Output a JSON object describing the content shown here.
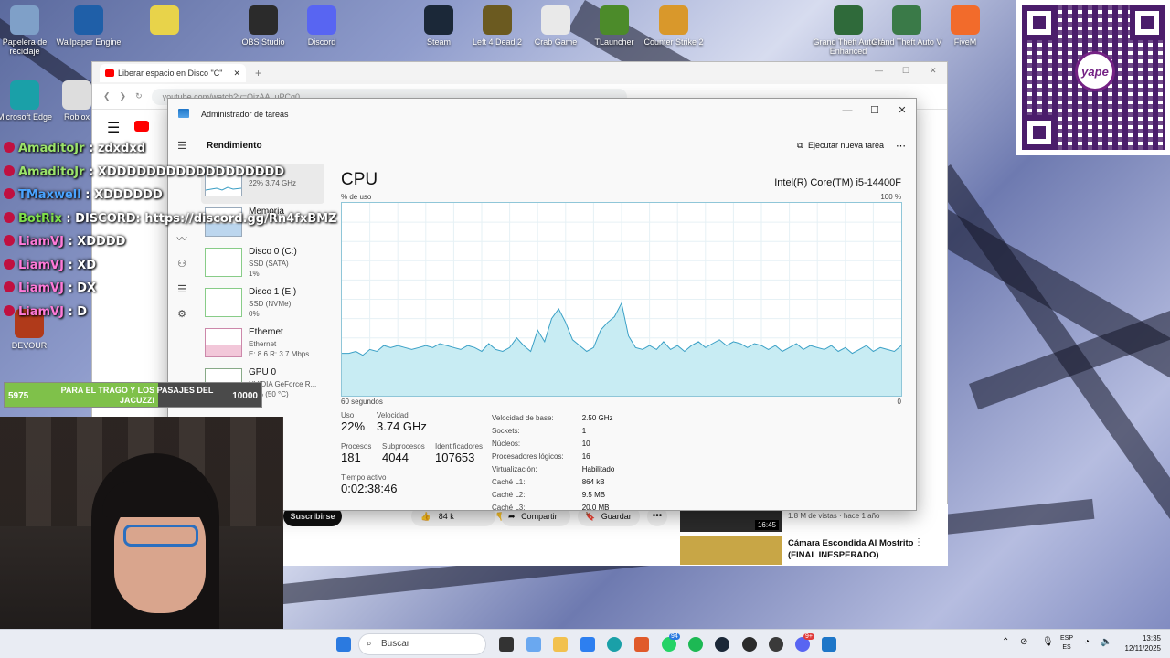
{
  "desktop_icons": [
    {
      "label": "Papelera de reciclaje",
      "color": "#7fa0c8"
    },
    {
      "label": "Wallpaper Engine",
      "color": "#1f5fa8"
    },
    {
      "label": "",
      "color": "#e8d34a"
    },
    {
      "label": "OBS Studio",
      "color": "#2b2b2b"
    },
    {
      "label": "Discord",
      "color": "#5865f2"
    },
    {
      "label": "Steam",
      "color": "#1b2838"
    },
    {
      "label": "Left 4 Dead 2",
      "color": "#6b5a20"
    },
    {
      "label": "Crab Game",
      "color": "#e9e9e9"
    },
    {
      "label": "TLauncher",
      "color": "#4c8b2a"
    },
    {
      "label": "Counter Strike 2",
      "color": "#d9982b"
    },
    {
      "label": "Grand Theft Auto V Enhanced",
      "color": "#2f6a3a"
    },
    {
      "label": "Grand Theft Auto V",
      "color": "#3a7a48"
    },
    {
      "label": "FiveM",
      "color": "#f26b2b"
    },
    {
      "label": "Microsoft Edge",
      "color": "#1aa0a8"
    },
    {
      "label": "Roblox",
      "color": "#dddddd"
    },
    {
      "label": "DEVOUR",
      "color": "#b03a1a"
    }
  ],
  "qr": {
    "brand": "yape",
    "color": "#742284"
  },
  "browser": {
    "tab_title": "Liberar espacio en Disco \"C\"",
    "url": "youtube.com/watch?v=OjzAA_uPCg0",
    "subscribe_label": "Suscribirse",
    "likes": "84 k",
    "share_label": "Compartir",
    "save_label": "Guardar",
    "rec1_meta": "1.8 M de vistas · hace 1 año",
    "rec1_duration": "16:45",
    "rec2_title_line1": "Cámara Escondida Al Mostrito",
    "rec2_title_line2": "(FINAL INESPERADO)"
  },
  "task_manager": {
    "window_title": "Administrador de tareas",
    "page_title": "Rendimiento",
    "run_task_label": "Ejecutar nueva tarea",
    "perf_items": [
      {
        "name": "CPU",
        "sub1": "22%  3.74 GHz",
        "sub2": ""
      },
      {
        "name": "Memoria",
        "sub1": "",
        "sub2": ""
      },
      {
        "name": "Disco 0 (C:)",
        "sub1": "SSD (SATA)",
        "sub2": "1%"
      },
      {
        "name": "Disco 1 (E:)",
        "sub1": "SSD (NVMe)",
        "sub2": "0%"
      },
      {
        "name": "Ethernet",
        "sub1": "Ethernet",
        "sub2": "E: 8.6  R: 3.7 Mbps"
      },
      {
        "name": "GPU 0",
        "sub1": "NVIDIA GeForce R...",
        "sub2": "19% (50 °C)"
      }
    ],
    "cpu_title": "CPU",
    "cpu_model": "Intel(R) Core(TM) i5-14400F",
    "graph_ylabel": "% de uso",
    "graph_ymax": "100 %",
    "graph_xlabel": "60 segundos",
    "graph_xmin": "0",
    "stats": {
      "uso_label": "Uso",
      "uso_value": "22%",
      "vel_label": "Velocidad",
      "vel_value": "3.74 GHz",
      "proc_label": "Procesos",
      "proc_value": "181",
      "sub_label": "Subprocesos",
      "sub_value": "4044",
      "ident_label": "Identificadores",
      "ident_value": "107653",
      "tiempo_label": "Tiempo activo",
      "tiempo_value": "0:02:38:46"
    },
    "specs": [
      {
        "k": "Velocidad de base:",
        "v": "2.50 GHz"
      },
      {
        "k": "Sockets:",
        "v": "1"
      },
      {
        "k": "Núcleos:",
        "v": "10"
      },
      {
        "k": "Procesadores lógicos:",
        "v": "16"
      },
      {
        "k": "Virtualización:",
        "v": "Habilitado"
      },
      {
        "k": "Caché L1:",
        "v": "864 kB"
      },
      {
        "k": "Caché L2:",
        "v": "9.5 MB"
      },
      {
        "k": "Caché L3:",
        "v": "20.0 MB"
      }
    ],
    "cpu_history": [
      22,
      22,
      23,
      21,
      24,
      23,
      26,
      25,
      26,
      25,
      24,
      25,
      26,
      25,
      27,
      26,
      25,
      24,
      26,
      25,
      23,
      27,
      24,
      23,
      25,
      30,
      26,
      23,
      34,
      28,
      40,
      45,
      38,
      29,
      26,
      23,
      25,
      34,
      38,
      41,
      48,
      31,
      25,
      24,
      26,
      24,
      28,
      24,
      26,
      23,
      26,
      28,
      25,
      27,
      29,
      26,
      28,
      27,
      25,
      27,
      26,
      24,
      26,
      23,
      25,
      27,
      24,
      26,
      25,
      24,
      26,
      23,
      25,
      22,
      24,
      26,
      23,
      25,
      24,
      23,
      26
    ]
  },
  "chat": [
    {
      "user": "AmaditoJr",
      "msg": "zdxdxd",
      "color": "#9be36a"
    },
    {
      "user": "AmaditoJr",
      "msg": "XDDDDDDDDDDDDDDDDDD",
      "color": "#9be36a"
    },
    {
      "user": "TMaxwell",
      "msg": "XDDDDDD",
      "color": "#4aa3ff"
    },
    {
      "user": "BotRix",
      "msg": "DISCORD: https://discord.gg/Rn4fxBMZ",
      "color": "#7fe04a"
    },
    {
      "user": "LiamVJ",
      "msg": "XDDDD",
      "color": "#ff7ad9"
    },
    {
      "user": "LiamVJ",
      "msg": "XD",
      "color": "#ff7ad9"
    },
    {
      "user": "LiamVJ",
      "msg": "DX",
      "color": "#ff7ad9"
    },
    {
      "user": "LiamVJ",
      "msg": "D",
      "color": "#ff7ad9"
    }
  ],
  "goal": {
    "current": "5975",
    "target": "10000",
    "text": "PARA EL TRAGO Y LOS PASAJES DEL JACUZZI",
    "progress": 0.5975
  },
  "taskbar": {
    "search_placeholder": "Buscar",
    "lang1": "ESP",
    "lang2": "ES",
    "time": "13:35",
    "date": "12/11/2025",
    "whatsapp_badge": "94",
    "discord_badge": "9+"
  }
}
